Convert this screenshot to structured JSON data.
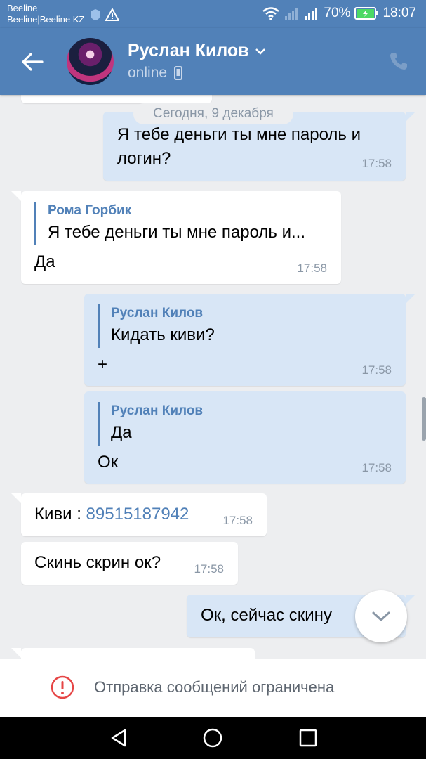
{
  "status_bar": {
    "carrier_1": "Beeline",
    "carrier_2": "Beeline|Beeline KZ",
    "battery": "70%",
    "time": "18:07"
  },
  "header": {
    "contact_name": "Руслан Килов",
    "status": "online",
    "accent_color": "#5181b8"
  },
  "chat": {
    "date_separator": "Сегодня, 9 декабря",
    "messages": [
      {
        "direction": "out",
        "text_line1": "Я тебе деньги ты мне пароль и",
        "text_line2": "логин?",
        "time": "17:58"
      },
      {
        "direction": "in",
        "reply_author": "Рома Горбик",
        "reply_text": "Я тебе деньги ты мне пароль и...",
        "text": "Да",
        "time": "17:58"
      },
      {
        "direction": "out",
        "reply_author": "Руслан Килов",
        "reply_text": "Кидать киви?",
        "text": "+",
        "time": "17:58"
      },
      {
        "direction": "out",
        "reply_author": "Руслан Килов",
        "reply_text": "Да",
        "text": "Ок",
        "time": "17:58"
      },
      {
        "direction": "in",
        "text_prefix": "Киви : ",
        "link": "89515187942",
        "time": "17:58"
      },
      {
        "direction": "in",
        "text": "Скинь скрин ок?",
        "time": "17:58"
      },
      {
        "direction": "out",
        "text": "Ок, сейчас скину"
      }
    ]
  },
  "restriction": {
    "text": "Отправка сообщений ограничена"
  }
}
